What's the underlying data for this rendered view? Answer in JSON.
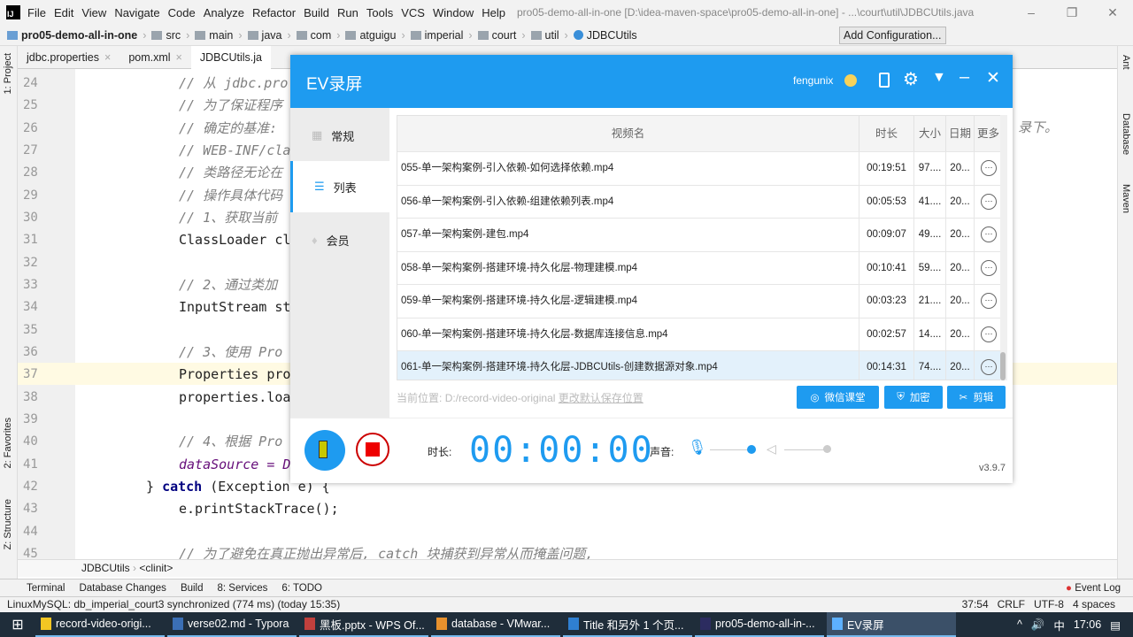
{
  "ide": {
    "menu": [
      "File",
      "Edit",
      "View",
      "Navigate",
      "Code",
      "Analyze",
      "Refactor",
      "Build",
      "Run",
      "Tools",
      "VCS",
      "Window",
      "Help"
    ],
    "window_title": "pro05-demo-all-in-one [D:\\idea-maven-space\\pro05-demo-all-in-one] - ...\\court\\util\\JDBCUtils.java",
    "breadcrumbs": [
      "pro05-demo-all-in-one",
      "src",
      "main",
      "java",
      "com",
      "atguigu",
      "imperial",
      "court",
      "util",
      "JDBCUtils"
    ],
    "add_configuration": "Add Configuration...",
    "tabs": [
      "jdbc.properties",
      "pom.xml",
      "JDBCUtils.ja"
    ],
    "left_tools": [
      "1: Project",
      "2: Favorites",
      "Z: Structure"
    ],
    "right_tools": [
      "Ant",
      "Database",
      "Maven"
    ],
    "lines": [
      {
        "n": "24",
        "t": "// 从 jdbc.pro",
        "c": "cm"
      },
      {
        "n": "25",
        "t": "// 为了保证程序",
        "c": "cm"
      },
      {
        "n": "26",
        "t": "// 确定的基准:",
        "c": "cm"
      },
      {
        "n": "27",
        "t": "// WEB-INF/cla",
        "c": "cm"
      },
      {
        "n": "28",
        "t": "// 类路径无论在",
        "c": "cm"
      },
      {
        "n": "29",
        "t": "// 操作具体代码",
        "c": "cm"
      },
      {
        "n": "30",
        "t": "// 1、获取当前",
        "c": "cm"
      },
      {
        "n": "31",
        "t": "ClassLoader cl",
        "c": ""
      },
      {
        "n": "32",
        "t": "",
        "c": ""
      },
      {
        "n": "33",
        "t": "// 2、通过类加",
        "c": "cm"
      },
      {
        "n": "34",
        "t": "InputStream st",
        "c": ""
      },
      {
        "n": "35",
        "t": "",
        "c": ""
      },
      {
        "n": "36",
        "t": "// 3、使用 Pro",
        "c": "cm"
      },
      {
        "n": "37",
        "t": "Properties pro",
        "c": ""
      },
      {
        "n": "38",
        "t": "properties.loa",
        "c": ""
      },
      {
        "n": "39",
        "t": "",
        "c": ""
      },
      {
        "n": "40",
        "t": "// 4、根据 Pro",
        "c": "cm"
      },
      {
        "n": "41",
        "t": "dataSource = D",
        "c": "fld"
      },
      {
        "n": "42",
        "t": "",
        "c": ""
      },
      {
        "n": "43",
        "t": "e.printStackTrace();",
        "c": ""
      },
      {
        "n": "44",
        "t": "",
        "c": ""
      },
      {
        "n": "45",
        "t": "// 为了避免在真正抛出异常后, catch 块捕获到异常从而掩盖问题,",
        "c": "cm"
      }
    ],
    "line42": {
      "brace": "} ",
      "kw": "catch",
      "rest": " (Exception e) {"
    },
    "line26_tail": "录下。",
    "code_breadcrumb": [
      "JDBCUtils",
      "<clinit>"
    ],
    "toolwindows": [
      "Terminal",
      "Database Changes",
      "Build",
      "8: Services",
      "6: TODO"
    ],
    "event_log": "Event Log",
    "status_message": "LinuxMySQL: db_imperial_court3 synchronized (774 ms) (today 15:35)",
    "status_right": [
      "37:54",
      "CRLF",
      "UTF-8",
      "4 spaces"
    ]
  },
  "ev": {
    "title": "EV录屏",
    "user": "fengunix",
    "sidebar": [
      "常规",
      "列表",
      "会员"
    ],
    "columns": [
      "视频名",
      "时长",
      "大小",
      "日期",
      "更多"
    ],
    "rows": [
      {
        "name": "055-单一架构案例-引入依赖-如何选择依赖.mp4",
        "dur": "00:19:51",
        "size": "97....",
        "date": "20..."
      },
      {
        "name": "056-单一架构案例-引入依赖-组建依赖列表.mp4",
        "dur": "00:05:53",
        "size": "41....",
        "date": "20..."
      },
      {
        "name": "057-单一架构案例-建包.mp4",
        "dur": "00:09:07",
        "size": "49....",
        "date": "20..."
      },
      {
        "name": "058-单一架构案例-搭建环境-持久化层-物理建模.mp4",
        "dur": "00:10:41",
        "size": "59....",
        "date": "20..."
      },
      {
        "name": "059-单一架构案例-搭建环境-持久化层-逻辑建模.mp4",
        "dur": "00:03:23",
        "size": "21....",
        "date": "20..."
      },
      {
        "name": "060-单一架构案例-搭建环境-持久化层-数据库连接信息.mp4",
        "dur": "00:02:57",
        "size": "14....",
        "date": "20..."
      },
      {
        "name": "061-单一架构案例-搭建环境-持久化层-JDBCUtils-创建数据源对象.mp4",
        "dur": "00:14:31",
        "size": "74....",
        "date": "20..."
      }
    ],
    "path_label": "当前位置:",
    "path": "D:/record-video-original",
    "change_path": "更改默认保存位置",
    "buttons": [
      "微信课堂",
      "加密",
      "剪辑"
    ],
    "duration_label": "时长:",
    "timer": "00:00:00",
    "sound_label": "声音:",
    "version": "v3.9.7",
    "accent": "#1e9bf0"
  },
  "taskbar": {
    "items": [
      "record-video-origi...",
      "verse02.md - Typora",
      "黑板.pptx - WPS Of...",
      "database - VMwar...",
      "Title 和另外 1 个页...",
      "pro05-demo-all-in-...",
      "EV录屏"
    ],
    "ime": "中",
    "time": "17:06"
  }
}
